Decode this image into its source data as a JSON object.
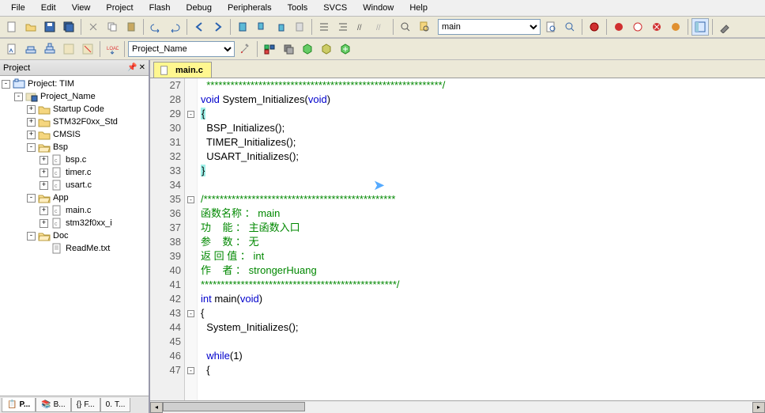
{
  "menu": [
    "File",
    "Edit",
    "View",
    "Project",
    "Flash",
    "Debug",
    "Peripherals",
    "Tools",
    "SVCS",
    "Window",
    "Help"
  ],
  "toolbar1": {
    "target_name": "main",
    "project_name": "Project_Name"
  },
  "project_panel": {
    "title": "Project",
    "tree": [
      {
        "depth": 0,
        "toggle": "-",
        "icon": "workspace",
        "label": "Project: TIM"
      },
      {
        "depth": 1,
        "toggle": "-",
        "icon": "target",
        "label": "Project_Name"
      },
      {
        "depth": 2,
        "toggle": "+",
        "icon": "folder-y",
        "label": "Startup Code"
      },
      {
        "depth": 2,
        "toggle": "+",
        "icon": "folder-y",
        "label": "STM32F0xx_Std"
      },
      {
        "depth": 2,
        "toggle": "+",
        "icon": "folder-y",
        "label": "CMSIS"
      },
      {
        "depth": 2,
        "toggle": "-",
        "icon": "folder-o",
        "label": "Bsp"
      },
      {
        "depth": 3,
        "toggle": "+",
        "icon": "cfile",
        "label": "bsp.c"
      },
      {
        "depth": 3,
        "toggle": "+",
        "icon": "cfile",
        "label": "timer.c"
      },
      {
        "depth": 3,
        "toggle": "+",
        "icon": "cfile",
        "label": "usart.c"
      },
      {
        "depth": 2,
        "toggle": "-",
        "icon": "folder-o",
        "label": "App"
      },
      {
        "depth": 3,
        "toggle": "+",
        "icon": "cfile",
        "label": "main.c"
      },
      {
        "depth": 3,
        "toggle": "+",
        "icon": "cfile",
        "label": "stm32f0xx_i"
      },
      {
        "depth": 2,
        "toggle": "-",
        "icon": "folder-o",
        "label": "Doc"
      },
      {
        "depth": 3,
        "toggle": "",
        "icon": "txtfile",
        "label": "ReadMe.txt"
      }
    ],
    "bottom_tabs": [
      {
        "icon": "📋",
        "label": "P..."
      },
      {
        "icon": "📚",
        "label": "B..."
      },
      {
        "icon": "{}",
        "label": "F..."
      },
      {
        "icon": "0.",
        "label": "T..."
      }
    ]
  },
  "editor": {
    "active_tab": "main.c",
    "code": [
      {
        "n": 27,
        "fold": "",
        "html": "<span class='cm'>  ***********************************************************/</span>"
      },
      {
        "n": 28,
        "fold": "",
        "html": "<span class='kw'>void</span> System_Initializes(<span class='kw'>void</span>)"
      },
      {
        "n": 29,
        "fold": "-",
        "html": "<span class='br-y'>{</span>"
      },
      {
        "n": 30,
        "fold": "",
        "html": "  BSP_Initializes();"
      },
      {
        "n": 31,
        "fold": "",
        "html": "  TIMER_Initializes();"
      },
      {
        "n": 32,
        "fold": "",
        "html": "  USART_Initializes();"
      },
      {
        "n": 33,
        "fold": "",
        "html": "<span class='br-y'>}</span>"
      },
      {
        "n": 34,
        "fold": "",
        "html": ""
      },
      {
        "n": 35,
        "fold": "-",
        "html": "<span class='cm'>/************************************************</span>"
      },
      {
        "n": 36,
        "fold": "",
        "html": "<span class='cm'>函数名称 ： main</span>"
      },
      {
        "n": 37,
        "fold": "",
        "html": "<span class='cm'>功    能 ： 主函数入口</span>"
      },
      {
        "n": 38,
        "fold": "",
        "html": "<span class='cm'>参    数 ： 无</span>"
      },
      {
        "n": 39,
        "fold": "",
        "html": "<span class='cm'>返 回 值 ： int</span>"
      },
      {
        "n": 40,
        "fold": "",
        "html": "<span class='cm'>作    者 ： strongerHuang</span>"
      },
      {
        "n": 41,
        "fold": "",
        "html": "<span class='cm'>*************************************************/</span>"
      },
      {
        "n": 42,
        "fold": "",
        "html": "<span class='kw'>int</span> main(<span class='kw'>void</span>)"
      },
      {
        "n": 43,
        "fold": "-",
        "html": "{"
      },
      {
        "n": 44,
        "fold": "",
        "html": "  System_Initializes();"
      },
      {
        "n": 45,
        "fold": "",
        "html": ""
      },
      {
        "n": 46,
        "fold": "",
        "html": "  <span class='kw'>while</span>(1)"
      },
      {
        "n": 47,
        "fold": "-",
        "html": "  {"
      }
    ]
  }
}
